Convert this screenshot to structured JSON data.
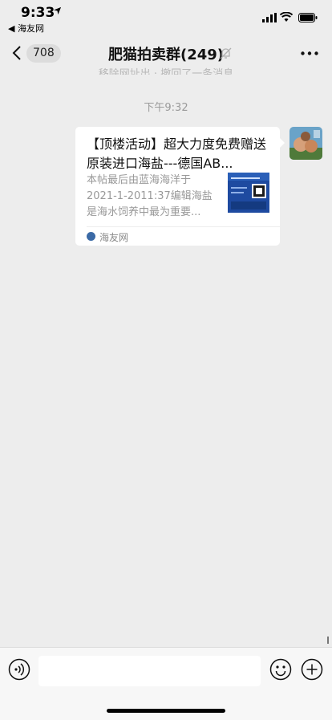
{
  "status_bar": {
    "time": "9:33",
    "back_app": "◀ 海友网"
  },
  "nav": {
    "unread_count": "708",
    "title": "肥猫拍卖群(249)"
  },
  "faded_notice": "移除网址出 · 撤回了一条消息",
  "timestamp": "下午9:32",
  "message": {
    "title": "【顶楼活动】超大力度免费赠送原装进口海盐---德国AB...",
    "description": "本帖最后由蓝海海洋于2021-1-2011:37编辑海盐是海水饲养中最为重要...",
    "source_name": "海友网"
  },
  "icons": {
    "back": "chevron-left-icon",
    "mute": "bell-off-icon",
    "more": "more-dots-icon",
    "voice": "voice-icon",
    "emoji": "emoji-icon",
    "plus": "plus-icon",
    "location": "location-arrow-icon"
  },
  "colors": {
    "background": "#ededed",
    "bubble": "#ffffff",
    "source_dot": "#3b6aa6"
  }
}
